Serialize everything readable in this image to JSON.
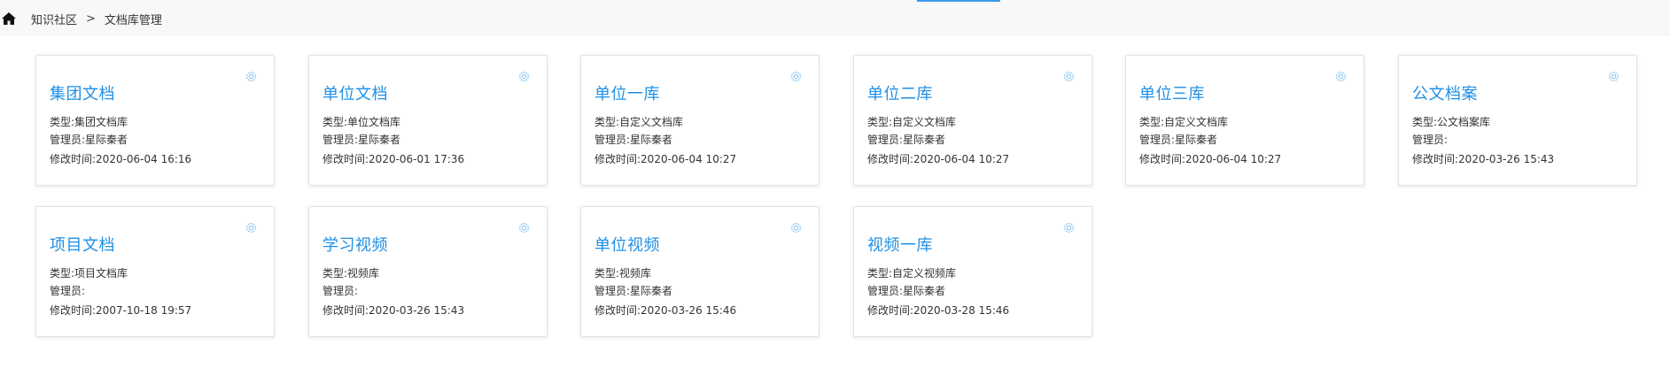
{
  "breadcrumb": {
    "home_icon": "home-icon",
    "items": [
      "知识社区",
      "文档库管理"
    ],
    "separator": ">"
  },
  "colors": {
    "title_blue": "#1e8fe6",
    "accent": "#3d9be9",
    "gear": "#8ec7ef"
  },
  "cards": [
    {
      "title": "集团文档",
      "type": "类型:集团文档库",
      "admin": "管理员:星际秦者",
      "time": "修改时间:2020-06-04 16:16",
      "icon": "settings-icon"
    },
    {
      "title": "单位文档",
      "type": "类型:单位文档库",
      "admin": "管理员:星际秦者",
      "time": "修改时间:2020-06-01 17:36",
      "icon": "settings-icon"
    },
    {
      "title": "单位一库",
      "type": "类型:自定义文档库",
      "admin": "管理员:星际秦者",
      "time": "修改时间:2020-06-04 10:27",
      "icon": "settings-icon"
    },
    {
      "title": "单位二库",
      "type": "类型:自定义文档库",
      "admin": "管理员:星际秦者",
      "time": "修改时间:2020-06-04 10:27",
      "icon": "settings-icon"
    },
    {
      "title": "单位三库",
      "type": "类型:自定义文档库",
      "admin": "管理员:星际秦者",
      "time": "修改时间:2020-06-04 10:27",
      "icon": "settings-icon"
    },
    {
      "title": "公文档案",
      "type": "类型:公文档案库",
      "admin": "管理员:",
      "time": "修改时间:2020-03-26 15:43",
      "icon": "settings-icon"
    },
    {
      "title": "项目文档",
      "type": "类型:项目文档库",
      "admin": "管理员:",
      "time": "修改时间:2007-10-18 19:57",
      "icon": "settings-icon"
    },
    {
      "title": "学习视频",
      "type": "类型:视频库",
      "admin": "管理员:",
      "time": "修改时间:2020-03-26 15:43",
      "icon": "settings-icon"
    },
    {
      "title": "单位视频",
      "type": "类型:视频库",
      "admin": "管理员:星际秦者",
      "time": "修改时间:2020-03-26 15:46",
      "icon": "settings-icon"
    },
    {
      "title": "视频一库",
      "type": "类型:自定义视频库",
      "admin": "管理员:星际秦者",
      "time": "修改时间:2020-03-28 15:46",
      "icon": "settings-icon"
    }
  ]
}
